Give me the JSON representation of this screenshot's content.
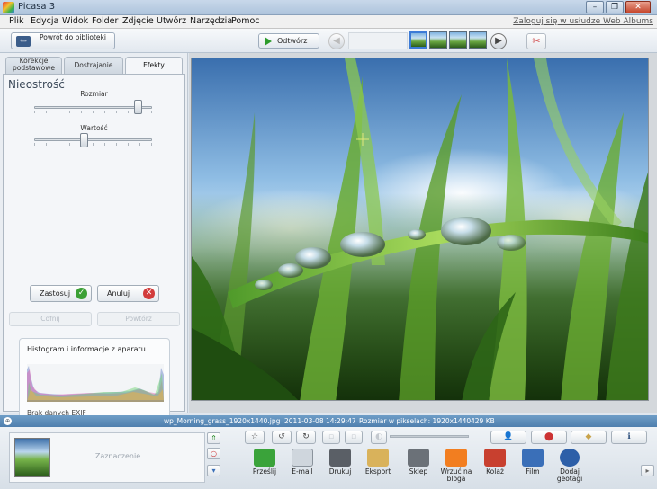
{
  "window": {
    "title": "Picasa 3",
    "controls": [
      "–",
      "❐",
      "✕"
    ]
  },
  "menu": {
    "items": [
      "Plik",
      "Edycja",
      "Widok",
      "Folder",
      "Zdjęcie",
      "Utwórz",
      "Narzędzia",
      "Pomoc"
    ],
    "login_link": "Zaloguj się w usłudze Web Albums"
  },
  "toolbar": {
    "back_label": "Powrót do biblioteki",
    "play_label": "Odtwórz"
  },
  "tabs": [
    {
      "label": "Korekcje podstawowe",
      "active": false
    },
    {
      "label": "Dostrajanie",
      "active": false
    },
    {
      "label": "Efekty",
      "active": true
    }
  ],
  "effect": {
    "title": "Nieostrość",
    "size_label": "Rozmiar",
    "size_value": 0.88,
    "amount_label": "Wartość",
    "amount_value": 0.42,
    "apply_label": "Zastosuj",
    "cancel_label": "Anuluj",
    "undo_label": "Cofnij",
    "redo_label": "Powtórz"
  },
  "histogram": {
    "title": "Histogram i informacje z aparatu",
    "exif": "Brak danych EXIF"
  },
  "status": {
    "filename": "wp_Morning_grass_1920x1440.jpg",
    "date": "2011-03-08 14:29:47",
    "size_label": "Rozmiar w pikselach: 1920x1440",
    "filesize": "429 KB"
  },
  "tray": {
    "selection_label": "Zaznaczenie",
    "tools": [
      {
        "label": "Prześlij",
        "icon": "upload-icon",
        "color": "#3aa33a"
      },
      {
        "label": "E-mail",
        "icon": "email-icon",
        "color": "#cfd6dd"
      },
      {
        "label": "Drukuj",
        "icon": "print-icon",
        "color": "#5a5f66"
      },
      {
        "label": "Eksport",
        "icon": "folder-icon",
        "color": "#d9b25b"
      },
      {
        "label": "Sklep",
        "icon": "shop-icon",
        "color": "#6b7178"
      },
      {
        "label": "Wrzuć na bloga",
        "icon": "blogger-icon",
        "color": "#f27e20"
      },
      {
        "label": "Kolaż",
        "icon": "collage-icon",
        "color": "#c8402f"
      },
      {
        "label": "Film",
        "icon": "film-icon",
        "color": "#3a6fb8"
      },
      {
        "label": "Dodaj geotagi",
        "icon": "earth-icon",
        "color": "#2d5fa8"
      }
    ]
  }
}
